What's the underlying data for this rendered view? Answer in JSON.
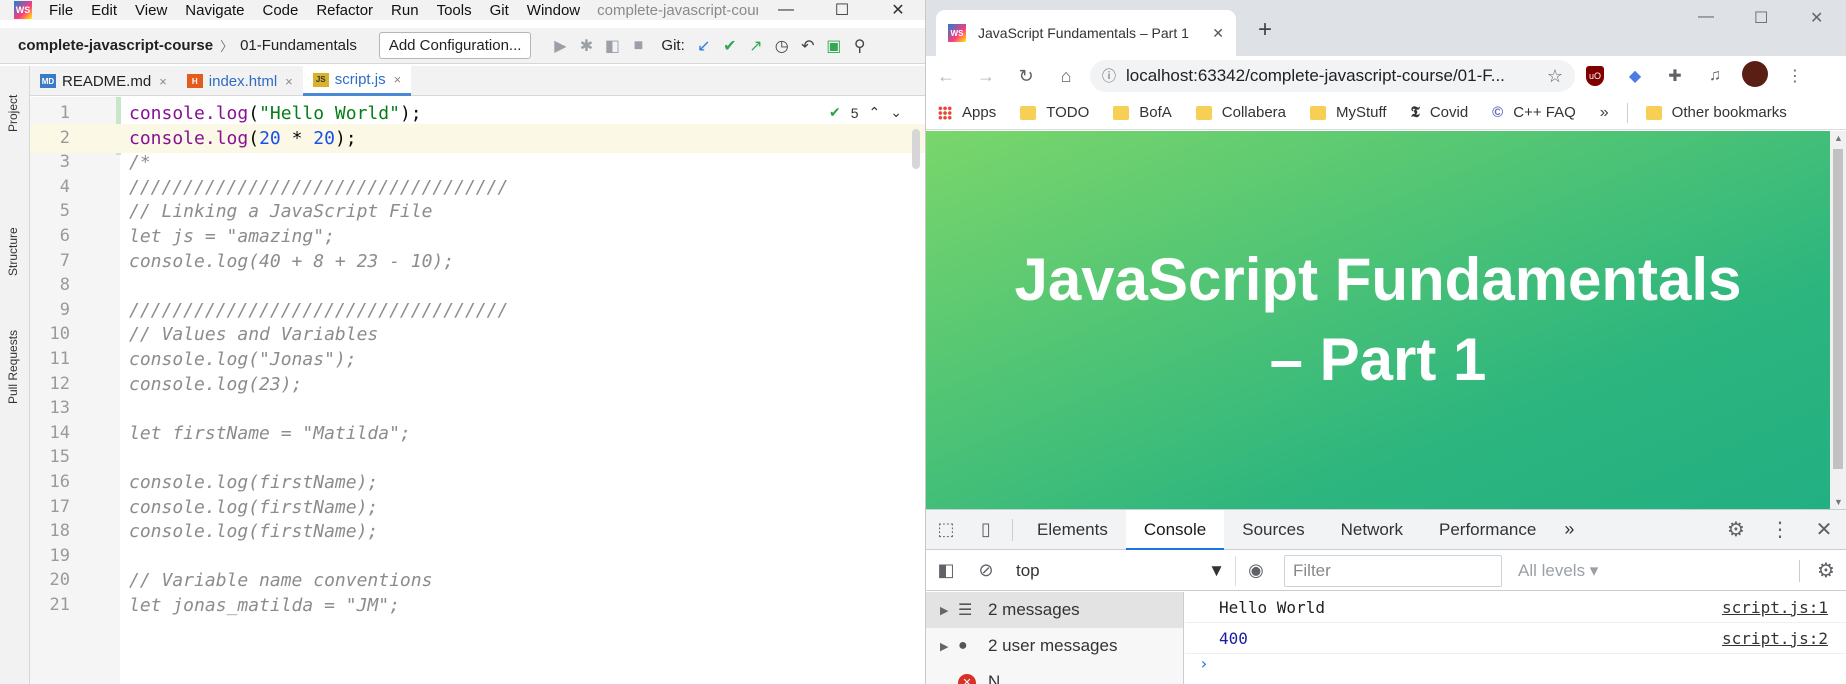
{
  "ide": {
    "menu": [
      {
        "label": "File",
        "mnemonic": "F"
      },
      {
        "label": "Edit",
        "mnemonic": "E"
      },
      {
        "label": "View",
        "mnemonic": "V"
      },
      {
        "label": "Navigate",
        "mnemonic": "N"
      },
      {
        "label": "Code",
        "mnemonic": "C"
      },
      {
        "label": "Refactor",
        "mnemonic": "R"
      },
      {
        "label": "Run",
        "mnemonic": "u"
      },
      {
        "label": "Tools",
        "mnemonic": "T"
      },
      {
        "label": "Git",
        "mnemonic": "G"
      },
      {
        "label": "Window",
        "mnemonic": "W"
      }
    ],
    "window_title": "complete-javascript-cours",
    "window_controls": {
      "minimize": "—",
      "maximize": "☐",
      "close": "✕"
    },
    "breadcrumb": {
      "project": "complete-javascript-course",
      "folder": "01-Fundamentals"
    },
    "add_config_label": "Add Configuration...",
    "git_label": "Git:",
    "tabs": [
      {
        "label": "README.md",
        "icon": "MD",
        "type": "md",
        "close": "×"
      },
      {
        "label": "index.html",
        "icon": "H",
        "type": "html",
        "close": "×"
      },
      {
        "label": "script.js",
        "icon": "JS",
        "type": "js",
        "close": "×"
      }
    ],
    "side_tabs": {
      "project": "Project",
      "structure": "Structure",
      "pull_requests": "Pull Requests"
    },
    "inspection": {
      "count": "5"
    },
    "code_lines": [
      {
        "n": "1",
        "text": "console.log(\"Hello World\");"
      },
      {
        "n": "2",
        "text": "console.log(20 * 20);"
      },
      {
        "n": "3",
        "text": "/*"
      },
      {
        "n": "4",
        "text": "///////////////////////////////////"
      },
      {
        "n": "5",
        "text": "// Linking a JavaScript File"
      },
      {
        "n": "6",
        "text": "let js = \"amazing\";"
      },
      {
        "n": "7",
        "text": "console.log(40 + 8 + 23 - 10);"
      },
      {
        "n": "8",
        "text": ""
      },
      {
        "n": "9",
        "text": "///////////////////////////////////"
      },
      {
        "n": "10",
        "text": "// Values and Variables"
      },
      {
        "n": "11",
        "text": "console.log(\"Jonas\");"
      },
      {
        "n": "12",
        "text": "console.log(23);"
      },
      {
        "n": "13",
        "text": ""
      },
      {
        "n": "14",
        "text": "let firstName = \"Matilda\";"
      },
      {
        "n": "15",
        "text": ""
      },
      {
        "n": "16",
        "text": "console.log(firstName);"
      },
      {
        "n": "17",
        "text": "console.log(firstName);"
      },
      {
        "n": "18",
        "text": "console.log(firstName);"
      },
      {
        "n": "19",
        "text": ""
      },
      {
        "n": "20",
        "text": "// Variable name conventions"
      },
      {
        "n": "21",
        "text": "let jonas_matilda = \"JM\";"
      }
    ]
  },
  "browser": {
    "tab_title": "JavaScript Fundamentals – Part 1",
    "tab_icon": "WS",
    "tab_close": "✕",
    "new_tab": "+",
    "url": "localhost:63342/complete-javascript-course/01-F...",
    "bookmarks": [
      "Apps",
      "TODO",
      "BofA",
      "Collabera",
      "MyStuff",
      "Covid",
      "C++ FAQ"
    ],
    "bookmarks_more": "»",
    "other_bookmarks": "Other bookmarks",
    "page_heading": "JavaScript Fundamentals – Part 1",
    "devtools": {
      "tabs": [
        "Elements",
        "Console",
        "Sources",
        "Network",
        "Performance"
      ],
      "active_tab": "Console",
      "more": "»",
      "context": "top",
      "filter_placeholder": "Filter",
      "levels": "All levels ▾",
      "sidebar": [
        {
          "label": "2 messages",
          "icon": "list-icon"
        },
        {
          "label": "2 user messages",
          "icon": "user-icon"
        },
        {
          "label": "N",
          "icon": "error-icon"
        }
      ],
      "messages": [
        {
          "value": "Hello World",
          "source": "script.js:1"
        },
        {
          "value": "400",
          "source": "script.js:2"
        }
      ],
      "prompt": "›"
    }
  },
  "colors": {
    "accent_blue": "#1a73e8",
    "page_green_start": "#7ad66b",
    "page_green_end": "#22af82"
  }
}
